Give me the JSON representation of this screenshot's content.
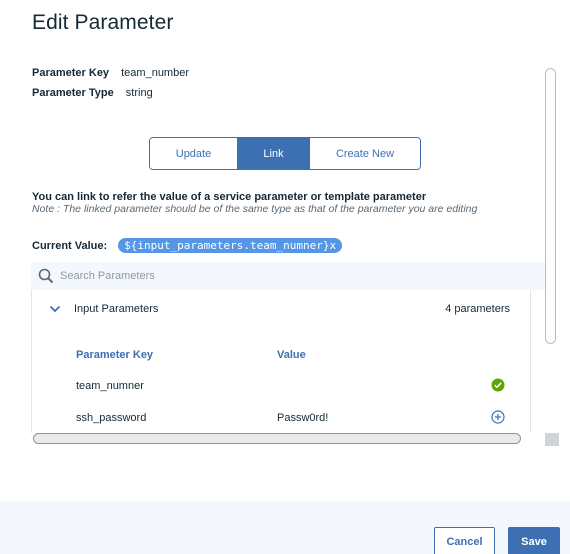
{
  "dialog": {
    "title": "Edit Parameter",
    "param_key_label": "Parameter Key",
    "param_key_value": "team_number",
    "param_type_label": "Parameter Type",
    "param_type_value": "string"
  },
  "tabs": [
    {
      "label": "Update",
      "active": false
    },
    {
      "label": "Link",
      "active": true
    },
    {
      "label": "Create New",
      "active": false
    }
  ],
  "link": {
    "description": "You can link to refer the value of a service parameter or template parameter",
    "note": "Note : The linked parameter should be of the same type as that of the parameter you are editing",
    "current_value_label": "Current Value:",
    "current_value": "${input_parameters.team_numner}x"
  },
  "search": {
    "placeholder": "Search Parameters",
    "value": ""
  },
  "accordion": {
    "title": "Input Parameters",
    "count": "4 parameters",
    "expanded": true,
    "columns": [
      "Parameter Key",
      "Value"
    ],
    "rows": [
      {
        "key": "team_numner",
        "value": "",
        "icon": "checkmark-filled-icon"
      },
      {
        "key": "ssh_password",
        "value": "Passw0rd!",
        "icon": "add-circle-icon"
      }
    ]
  },
  "footer": {
    "cancel_label": "Cancel",
    "save_label": "Save"
  },
  "colors": {
    "primary": "#3d70b2",
    "pill": "#5596e6",
    "success": "#5aa700",
    "footer_bg": "#f4f7fb"
  }
}
